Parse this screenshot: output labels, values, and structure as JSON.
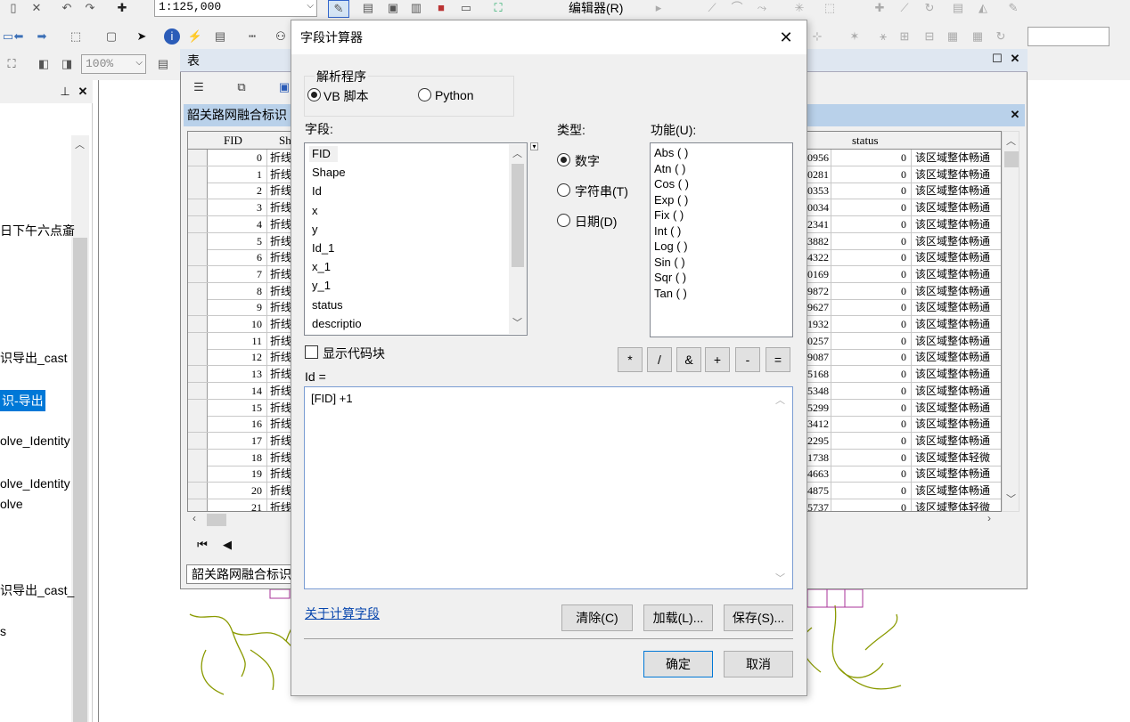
{
  "toolbar": {
    "scale_value": "1:125,000",
    "editor_label": "编辑器(R)",
    "zoom_value": "100%"
  },
  "toc": {
    "items": [
      {
        "label": "日下午六点齑",
        "selected": false
      },
      {
        "label": "识导出_cast",
        "selected": false
      },
      {
        "label": "识-导出",
        "selected": true
      },
      {
        "label": "olve_Identity",
        "selected": false
      },
      {
        "label": "olve_Identity",
        "selected": false
      },
      {
        "label": "olve",
        "selected": false
      },
      {
        "label": "识导出_cast_",
        "selected": false
      },
      {
        "label": "s",
        "selected": false
      }
    ]
  },
  "table_window": {
    "title": "表",
    "layer_tab": "韶关路网融合标识",
    "bottom_tab": "韶关路网融合标识",
    "columns_left": [
      "FID",
      "Sh"
    ],
    "columns_right": [
      "status"
    ],
    "rows": [
      {
        "fid": "0",
        "shape": "折线",
        "num": "0956",
        "status": "0",
        "desc": "该区域整体畅通"
      },
      {
        "fid": "1",
        "shape": "折线",
        "num": "0281",
        "status": "0",
        "desc": "该区域整体畅通"
      },
      {
        "fid": "2",
        "shape": "折线",
        "num": "0353",
        "status": "0",
        "desc": "该区域整体畅通"
      },
      {
        "fid": "3",
        "shape": "折线",
        "num": "0034",
        "status": "0",
        "desc": "该区域整体畅通"
      },
      {
        "fid": "4",
        "shape": "折线",
        "num": "2341",
        "status": "0",
        "desc": "该区域整体畅通"
      },
      {
        "fid": "5",
        "shape": "折线",
        "num": "3882",
        "status": "0",
        "desc": "该区域整体畅通"
      },
      {
        "fid": "6",
        "shape": "折线",
        "num": "4322",
        "status": "0",
        "desc": "该区域整体畅通"
      },
      {
        "fid": "7",
        "shape": "折线",
        "num": "0169",
        "status": "0",
        "desc": "该区域整体畅通"
      },
      {
        "fid": "8",
        "shape": "折线",
        "num": "9872",
        "status": "0",
        "desc": "该区域整体畅通"
      },
      {
        "fid": "9",
        "shape": "折线",
        "num": "9627",
        "status": "0",
        "desc": "该区域整体畅通"
      },
      {
        "fid": "10",
        "shape": "折线",
        "num": "1932",
        "status": "0",
        "desc": "该区域整体畅通"
      },
      {
        "fid": "11",
        "shape": "折线",
        "num": "0257",
        "status": "0",
        "desc": "该区域整体畅通"
      },
      {
        "fid": "12",
        "shape": "折线",
        "num": "9087",
        "status": "0",
        "desc": "该区域整体畅通"
      },
      {
        "fid": "13",
        "shape": "折线",
        "num": "5168",
        "status": "0",
        "desc": "该区域整体畅通"
      },
      {
        "fid": "14",
        "shape": "折线",
        "num": "5348",
        "status": "0",
        "desc": "该区域整体畅通"
      },
      {
        "fid": "15",
        "shape": "折线",
        "num": "5299",
        "status": "0",
        "desc": "该区域整体畅通"
      },
      {
        "fid": "16",
        "shape": "折线",
        "num": "3412",
        "status": "0",
        "desc": "该区域整体畅通"
      },
      {
        "fid": "17",
        "shape": "折线",
        "num": "2295",
        "status": "0",
        "desc": "该区域整体畅通"
      },
      {
        "fid": "18",
        "shape": "折线",
        "num": "1738",
        "status": "0",
        "desc": "该区域整体轻微"
      },
      {
        "fid": "19",
        "shape": "折线",
        "num": "4663",
        "status": "0",
        "desc": "该区域整体畅通"
      },
      {
        "fid": "20",
        "shape": "折线",
        "num": "4875",
        "status": "0",
        "desc": "该区域整体畅通"
      },
      {
        "fid": "21",
        "shape": "折线",
        "num": "5737",
        "status": "0",
        "desc": "该区域整体轻微"
      }
    ]
  },
  "dialog": {
    "title": "字段计算器",
    "parser_group": "解析程序",
    "parser_vb": "VB 脚本",
    "parser_python": "Python",
    "fields_label": "字段:",
    "fields": [
      "FID",
      "Shape",
      "Id",
      "x",
      "y",
      "Id_1",
      "x_1",
      "y_1",
      "status",
      "descriptio"
    ],
    "type_label": "类型:",
    "type_number": "数字",
    "type_string": "字符串(T)",
    "type_date": "日期(D)",
    "functions_label": "功能(U):",
    "functions": [
      "Abs ( )",
      "Atn ( )",
      "Cos ( )",
      "Exp ( )",
      "Fix ( )",
      "Int ( )",
      "Log ( )",
      "Sin ( )",
      "Sqr ( )",
      "Tan ( )"
    ],
    "show_codeblock": "显示代码块",
    "operators": [
      "*",
      "/",
      "&",
      "+",
      "-",
      "="
    ],
    "expr_label": "Id =",
    "expression": "[FID] +1",
    "about_link": "关于计算字段",
    "clear_button": "清除(C)",
    "load_button": "加载(L)...",
    "save_button": "保存(S)...",
    "ok_button": "确定",
    "cancel_button": "取消"
  }
}
